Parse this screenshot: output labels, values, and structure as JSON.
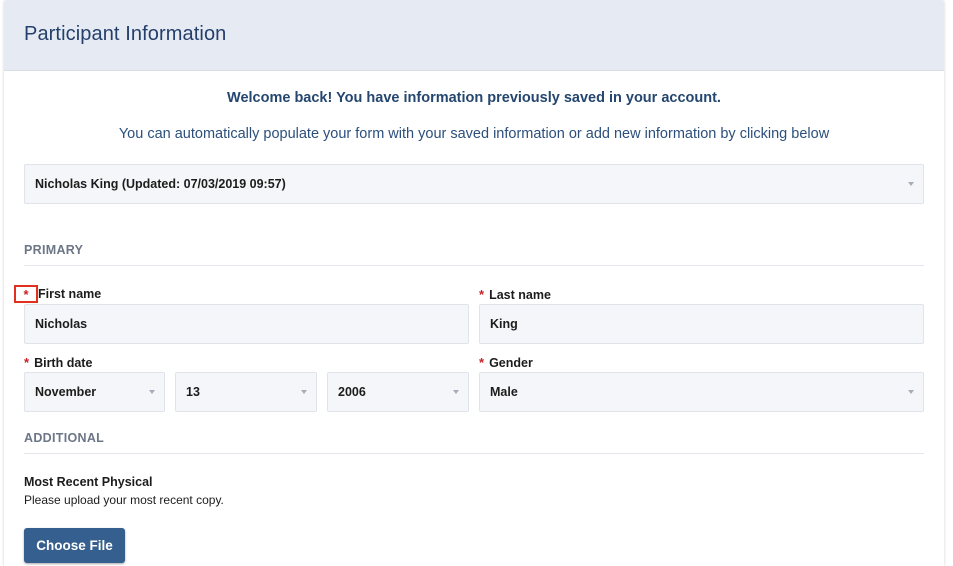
{
  "header": {
    "title": "Participant Information"
  },
  "intro": {
    "welcome": "Welcome back! You have information previously saved in your account.",
    "subtext": "You can automatically populate your form with your saved information or add new information by clicking below"
  },
  "saved_profile": {
    "selected": "Nicholas King (Updated: 07/03/2019 09:57)"
  },
  "sections": {
    "primary": "PRIMARY",
    "additional": "ADDITIONAL"
  },
  "required_marker": "*",
  "fields": {
    "first_name": {
      "label": "First name",
      "value": "Nicholas"
    },
    "last_name": {
      "label": "Last name",
      "value": "King"
    },
    "birth_date": {
      "label": "Birth date",
      "month": "November",
      "day": "13",
      "year": "2006"
    },
    "gender": {
      "label": "Gender",
      "value": "Male"
    }
  },
  "upload": {
    "title": "Most Recent Physical",
    "note": "Please upload your most recent copy.",
    "button_label": "Choose File"
  },
  "colors": {
    "header_bg": "#e6ebf3",
    "title": "#243f6b",
    "required": "#c8202b",
    "highlight_box": "#e0301e",
    "button": "#355f8f"
  }
}
